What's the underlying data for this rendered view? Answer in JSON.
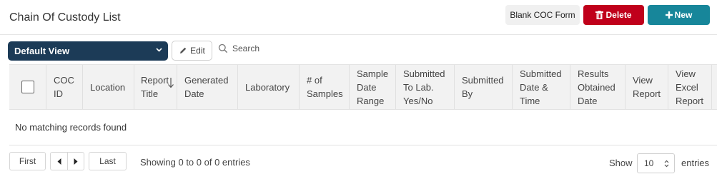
{
  "page": {
    "title": "Chain Of Custody List"
  },
  "toolbar": {
    "blank_coc_label": "Blank COC Form",
    "delete_label": "Delete",
    "new_label": "New",
    "view_select_value": "Default View",
    "edit_label": "Edit",
    "search_label": "Search"
  },
  "table": {
    "columns": [
      {
        "label": "COC ID"
      },
      {
        "label": "Location"
      },
      {
        "label": "Report Title"
      },
      {
        "label": "Generated Date"
      },
      {
        "label": "Laboratory"
      },
      {
        "label": "# of Samples"
      },
      {
        "label": "Sample Date Range"
      },
      {
        "label": "Submitted To Lab. Yes/No"
      },
      {
        "label": "Submitted By"
      },
      {
        "label": "Submitted Date & Time"
      },
      {
        "label": "Results Obtained Date"
      },
      {
        "label": "View Report"
      },
      {
        "label": "View Excel Report"
      }
    ],
    "empty_message": "No matching records found"
  },
  "pagination": {
    "first_label": "First",
    "last_label": "Last",
    "info": "Showing 0 to 0 of 0 entries",
    "show_label": "Show",
    "page_size": "10",
    "entries_label": "entries"
  },
  "colors": {
    "delete": "#c0001b",
    "new": "#17869a",
    "view_select": "#1c3b57"
  }
}
